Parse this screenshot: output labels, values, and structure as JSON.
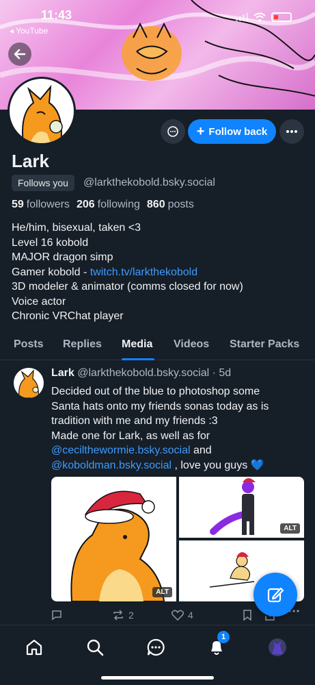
{
  "status": {
    "time": "11:43",
    "back_app": "◂ YouTube"
  },
  "profile": {
    "name": "Lark",
    "follows_you": "Follows you",
    "handle": "@larkthekobold.bsky.social",
    "followers_count": "59",
    "followers_label": "followers",
    "following_count": "206",
    "following_label": "following",
    "posts_count": "860",
    "posts_label": "posts",
    "follow_back_label": "Follow back",
    "bio_lines": [
      "He/him, bisexual, taken <3",
      "Level 16 kobold",
      "MAJOR dragon simp",
      "Gamer kobold - ",
      "3D modeler & animator (comms closed for now)",
      "Voice actor",
      "Chronic VRChat player"
    ],
    "bio_link": "twitch.tv/larkthekobold"
  },
  "tabs": [
    "Posts",
    "Replies",
    "Media",
    "Videos",
    "Starter Packs"
  ],
  "active_tab": "Media",
  "post": {
    "author": "Lark",
    "handle": "@larkthekobold.bsky.social",
    "age": "· 5d",
    "text_lines": [
      "Decided out of the blue to photoshop some",
      "Santa hats onto my friends sonas today as is",
      "tradition with me and my friends :3",
      "Made one for Lark, as well as for"
    ],
    "mention1": "@ceciltheworm ie.bsky.social",
    "mention1_clean": "@ceciltheworm ie.bsky.social",
    "mention1_display": "@ceciltheworm ie.bsky.social",
    "mention_a": "@cecilthewormie.bsky.social",
    "and_text": " and",
    "mention_b": "@koboldman.bsky.social",
    "tail_text": " , love you guys 💙",
    "alt_label": "ALT",
    "reposts": "2",
    "likes": "4"
  },
  "nav": {
    "notif_count": "1"
  },
  "colors": {
    "accent": "#1083fe",
    "bg": "#161e27",
    "link": "#3d9bff"
  }
}
